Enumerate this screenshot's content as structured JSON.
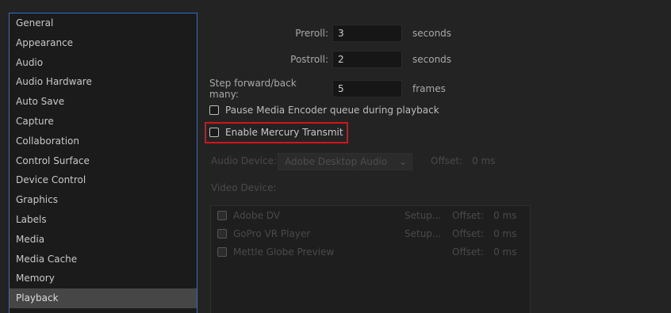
{
  "sidebar": {
    "items": [
      {
        "label": "General"
      },
      {
        "label": "Appearance"
      },
      {
        "label": "Audio"
      },
      {
        "label": "Audio Hardware"
      },
      {
        "label": "Auto Save"
      },
      {
        "label": "Capture"
      },
      {
        "label": "Collaboration"
      },
      {
        "label": "Control Surface"
      },
      {
        "label": "Device Control"
      },
      {
        "label": "Graphics"
      },
      {
        "label": "Labels"
      },
      {
        "label": "Media"
      },
      {
        "label": "Media Cache"
      },
      {
        "label": "Memory"
      },
      {
        "label": "Playback"
      }
    ],
    "selected": "Playback"
  },
  "playback": {
    "preroll_label": "Preroll:",
    "preroll_value": "3",
    "preroll_unit": "seconds",
    "postroll_label": "Postroll:",
    "postroll_value": "2",
    "postroll_unit": "seconds",
    "step_label": "Step forward/back many:",
    "step_value": "5",
    "step_unit": "frames",
    "pause_encoder_label": "Pause Media Encoder queue during playback",
    "mercury_label": "Enable Mercury Transmit",
    "audio_device_label": "Audio Device:",
    "audio_device_value": "Adobe Desktop Audio",
    "audio_offset_label": "Offset:",
    "audio_offset_value": "0 ms",
    "video_device_label": "Video Device:",
    "video_devices": [
      {
        "name": "Adobe DV",
        "setup": "Setup...",
        "offset_label": "Offset:",
        "offset_value": "0 ms"
      },
      {
        "name": "GoPro VR Player",
        "setup": "Setup...",
        "offset_label": "Offset:",
        "offset_value": "0 ms"
      },
      {
        "name": "Mettle Globe Preview",
        "setup": "",
        "offset_label": "Offset:",
        "offset_value": "0 ms"
      }
    ]
  }
}
